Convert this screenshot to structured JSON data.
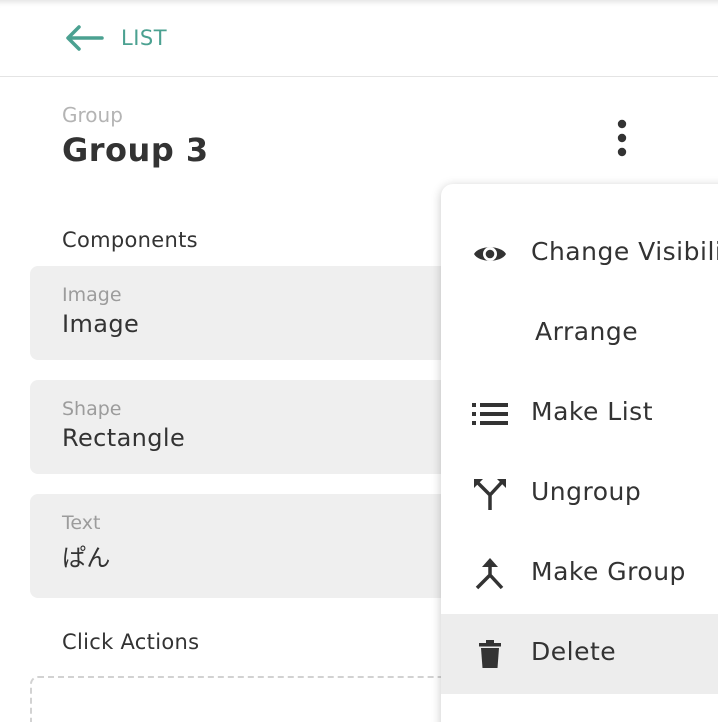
{
  "topbar": {
    "back_label": "LIST"
  },
  "header": {
    "type_label": "Group",
    "title": "Group 3"
  },
  "components": {
    "heading": "Components",
    "items": [
      {
        "type": "Image",
        "name": "Image"
      },
      {
        "type": "Shape",
        "name": "Rectangle"
      },
      {
        "type": "Text",
        "name": "ぱん"
      }
    ]
  },
  "click_actions": {
    "heading": "Click Actions"
  },
  "menu": {
    "items": [
      {
        "label": "Change Visibility",
        "icon": "eye-icon"
      },
      {
        "label": "Arrange",
        "icon": ""
      },
      {
        "label": "Make List",
        "icon": "list-icon"
      },
      {
        "label": "Ungroup",
        "icon": "split-icon"
      },
      {
        "label": "Make Group",
        "icon": "merge-icon"
      },
      {
        "label": "Delete",
        "icon": "trash-icon"
      }
    ],
    "highlighted": "Delete"
  },
  "colors": {
    "accent": "#4ba191",
    "card_bg": "#efefef",
    "menu_highlight": "#ededed"
  }
}
